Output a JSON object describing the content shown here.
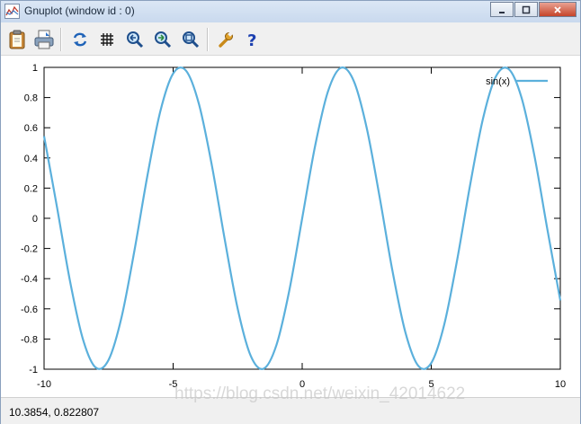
{
  "window": {
    "title": "Gnuplot (window id : 0)"
  },
  "toolbar": {
    "items": [
      {
        "icon": "clipboard-icon",
        "tooltip": ""
      },
      {
        "icon": "print-icon",
        "tooltip": ""
      },
      {
        "icon": "replot-icon",
        "tooltip": ""
      },
      {
        "icon": "grid-icon",
        "tooltip": ""
      },
      {
        "icon": "zoom-previous-icon",
        "tooltip": ""
      },
      {
        "icon": "zoom-next-icon",
        "tooltip": ""
      },
      {
        "icon": "autoscale-icon",
        "tooltip": ""
      },
      {
        "icon": "options-wrench-icon",
        "tooltip": ""
      },
      {
        "icon": "help-icon",
        "tooltip": ""
      }
    ]
  },
  "status": {
    "coords": "10.3854,   0.822807"
  },
  "watermark": "https://blog.csdn.net/weixin_42014622",
  "colors": {
    "series": "#5bb0dc",
    "titlebar": "#dbe7f5"
  },
  "chart_data": {
    "type": "line",
    "function": "sin(x)",
    "series": [
      {
        "name": "sin(x)",
        "x": [
          -10,
          -9.5,
          -9,
          -8.5,
          -8,
          -7.5,
          -7,
          -6.5,
          -6,
          -5.5,
          -5,
          -4.5,
          -4,
          -3.5,
          -3,
          -2.5,
          -2,
          -1.5,
          -1,
          -0.5,
          0,
          0.5,
          1,
          1.5,
          2,
          2.5,
          3,
          3.5,
          4,
          4.5,
          5,
          5.5,
          6,
          6.5,
          7,
          7.5,
          8,
          8.5,
          9,
          9.5,
          10
        ],
        "y": [
          0.544,
          0.075,
          -0.412,
          -0.798,
          -0.989,
          -0.938,
          -0.657,
          -0.215,
          0.279,
          0.706,
          0.959,
          0.978,
          0.757,
          0.351,
          -0.141,
          -0.598,
          -0.909,
          -0.997,
          -0.841,
          -0.479,
          0,
          0.479,
          0.841,
          0.997,
          0.909,
          0.598,
          0.141,
          -0.351,
          -0.757,
          -0.978,
          -0.959,
          -0.706,
          -0.279,
          0.215,
          0.657,
          0.938,
          0.989,
          0.798,
          0.412,
          -0.075,
          -0.544
        ]
      }
    ],
    "xlim": [
      -10,
      10
    ],
    "ylim": [
      -1,
      1
    ],
    "xticks": [
      -10,
      -5,
      0,
      5,
      10
    ],
    "xtick_labels": [
      "-10",
      "-5",
      "0",
      "5",
      "10"
    ],
    "yticks": [
      -1,
      -0.8,
      -0.6,
      -0.4,
      -0.2,
      0,
      0.2,
      0.4,
      0.6,
      0.8,
      1
    ],
    "ytick_labels": [
      "-1",
      "-0.8",
      "-0.6",
      "-0.4",
      "-0.2",
      "0",
      "0.2",
      "0.4",
      "0.6",
      "0.8",
      "1"
    ],
    "grid": false,
    "legend": "top-right",
    "title": "",
    "xlabel": "",
    "ylabel": ""
  }
}
